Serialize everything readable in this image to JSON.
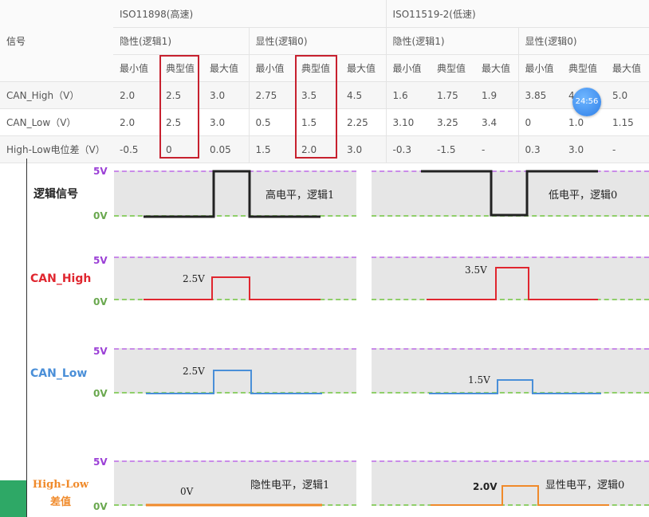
{
  "table": {
    "signal_header": "信号",
    "standards": [
      "ISO11898(高速)",
      "ISO11519-2(低速)"
    ],
    "states": [
      "隐性(逻辑1)",
      "显性(逻辑0)",
      "隐性(逻辑1)",
      "显性(逻辑0)"
    ],
    "stats": [
      "最小值",
      "典型值",
      "最大值",
      "最小值",
      "典型值",
      "最大值",
      "最小值",
      "典型值",
      "最大值",
      "最小值",
      "典型值",
      "最大值"
    ],
    "rows": [
      {
        "label": "CAN_High（V）",
        "values": [
          "2.0",
          "2.5",
          "3.0",
          "2.75",
          "3.5",
          "4.5",
          "1.6",
          "1.75",
          "1.9",
          "3.85",
          "4",
          "5.0"
        ]
      },
      {
        "label": "CAN_Low（V）",
        "values": [
          "2.0",
          "2.5",
          "3.0",
          "0.5",
          "1.5",
          "2.25",
          "3.10",
          "3.25",
          "3.4",
          "0",
          "1.0",
          "1.15"
        ]
      },
      {
        "label": "High-Low电位差（V）",
        "values": [
          "-0.5",
          "0",
          "0.05",
          "1.5",
          "2.0",
          "3.0",
          "-0.3",
          "-1.5",
          "-",
          "0.3",
          "3.0",
          "-"
        ]
      }
    ]
  },
  "clock_badge": "24:56",
  "diagram": {
    "volt_high": "5V",
    "volt_low": "0V",
    "rows": [
      {
        "title": "逻辑信号",
        "color": "#222222",
        "note_left": "高电平，逻辑1",
        "note_right": "低电平，逻辑0",
        "level_left": "",
        "level_right": ""
      },
      {
        "title": "CAN_High",
        "color": "#e0262f",
        "note_left": "",
        "note_right": "",
        "level_left": "2.5V",
        "level_right": "3.5V"
      },
      {
        "title": "CAN_Low",
        "color": "#4a8fd8",
        "note_left": "",
        "note_right": "",
        "level_left": "2.5V",
        "level_right": "1.5V"
      },
      {
        "title": "High-Low差值",
        "color": "#f08a2a",
        "note_left": "隐性电平，逻辑1",
        "note_right": "显性电平，逻辑0",
        "level_left": "0V",
        "level_right": "2.0V"
      }
    ],
    "colors": {
      "grid_top": "#c98be8",
      "grid_bottom": "#8fcf6a",
      "highlight_box": "#c7202e"
    }
  }
}
